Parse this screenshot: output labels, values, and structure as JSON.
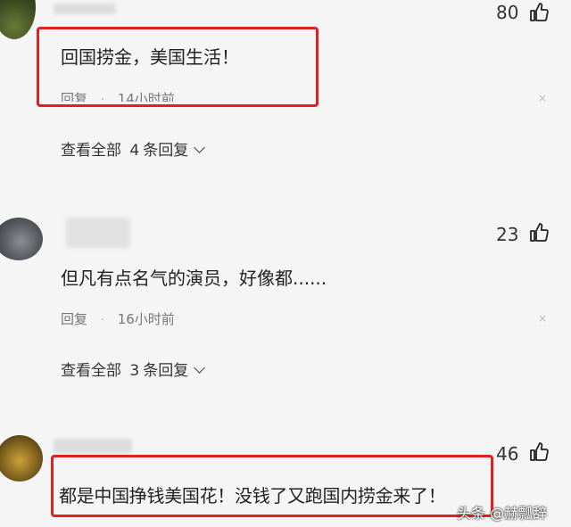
{
  "comments": [
    {
      "likes": "80",
      "text": "回国捞金，美国生活！",
      "reply_label": "回复",
      "time": "14小时前",
      "view_replies_prefix": "查看全部",
      "view_replies_count": "4",
      "view_replies_suffix": "条回复"
    },
    {
      "likes": "23",
      "text": "但凡有点名气的演员，好像都......",
      "reply_label": "回复",
      "time": "16小时前",
      "view_replies_prefix": "查看全部",
      "view_replies_count": "3",
      "view_replies_suffix": "条回复"
    },
    {
      "likes": "46",
      "text": "都是中国挣钱美国花！没钱了又跑国内捞金来了！"
    }
  ],
  "dot": "·",
  "close_glyph": "×",
  "watermark": "头条 @赫瓢辞",
  "colors": {
    "highlight_box": "#e0221f",
    "background": "#f5f5f5"
  },
  "icons": [
    "thumbs-up-icon",
    "close-icon",
    "chevron-down-icon"
  ]
}
